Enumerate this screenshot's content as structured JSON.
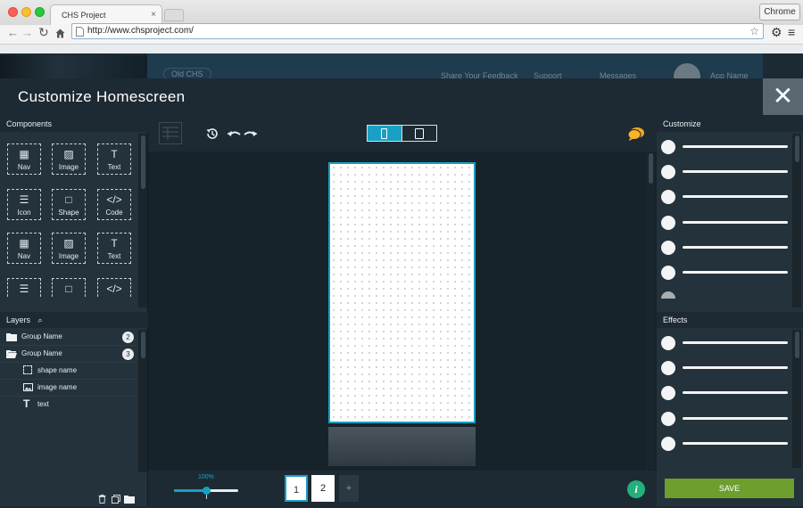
{
  "browser": {
    "tab_title": "CHS Project",
    "tab_close": "×",
    "chrome_label": "Chrome",
    "url": "http://www.chsproject.com/"
  },
  "background_app": {
    "nav_pill": "Old CHS",
    "feedback": "Share Your Feedback",
    "support": "Support",
    "messages": "Messages",
    "app_name": "App Name"
  },
  "modal": {
    "title": "Customize Homescreen",
    "close": "✕"
  },
  "components": {
    "heading": "Components",
    "items": [
      {
        "label": "Nav",
        "icon": "▦"
      },
      {
        "label": "Image",
        "icon": "▨"
      },
      {
        "label": "Text",
        "icon": "T"
      },
      {
        "label": "Icon",
        "icon": "☰"
      },
      {
        "label": "Shape",
        "icon": "□"
      },
      {
        "label": "Code",
        "icon": "</>"
      },
      {
        "label": "Nav",
        "icon": "▦"
      },
      {
        "label": "Image",
        "icon": "▨"
      },
      {
        "label": "Text",
        "icon": "T"
      }
    ],
    "partial_icons": [
      "☰",
      "□",
      "</>"
    ]
  },
  "layers": {
    "heading": "Layers",
    "items": [
      {
        "label": "Group Name",
        "badge": "2",
        "icon": "folder-icon"
      },
      {
        "label": "Group Name",
        "badge": "3",
        "icon": "folder-open-icon"
      },
      {
        "label": "shape name",
        "icon": "shape-icon"
      },
      {
        "label": "image name",
        "icon": "image-icon"
      },
      {
        "label": "text",
        "icon": "text-icon"
      }
    ]
  },
  "canvas": {
    "zoom_label": "100%",
    "zoom_value": 1.0,
    "pages": [
      "1",
      "2"
    ],
    "add_page": "+"
  },
  "customize": {
    "heading": "Customize",
    "slider_count": 6
  },
  "effects": {
    "heading": "Effects",
    "slider_count": 5
  },
  "save_label": "SAVE",
  "colors": {
    "accent": "#19a0c4",
    "save": "#6d9e2e",
    "panel": "#24323b",
    "chat": "#f2a81d"
  }
}
